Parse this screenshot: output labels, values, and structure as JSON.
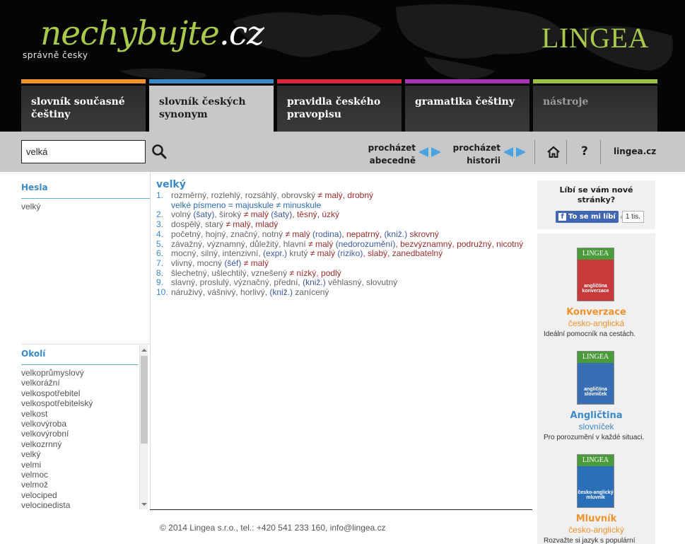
{
  "header": {
    "logo_main": "nechybujte",
    "logo_tld": ".cz",
    "tagline": "správně česky",
    "brand": "LINGEA"
  },
  "tabs": [
    {
      "label": "slovník současné češtiny",
      "color": "#f0922b",
      "state": "normal"
    },
    {
      "label": "slovník českých synonym",
      "color": "#3a89c9",
      "state": "active"
    },
    {
      "label": "pravidla českého pravopisu",
      "color": "#d12a3a",
      "state": "normal"
    },
    {
      "label": "gramatika češtiny",
      "color": "#a535b3",
      "state": "normal"
    },
    {
      "label": "nástroje",
      "color": "#9bc04a",
      "state": "disabled"
    }
  ],
  "toolbar": {
    "search_value": "velká",
    "search_icon": "search-icon",
    "browse_alpha_line1": "procházet",
    "browse_alpha_line2": "abecedně",
    "browse_history_line1": "procházet",
    "browse_history_line2": "historii",
    "home_icon": "home-icon",
    "help_label": "?",
    "site_link": "lingea.cz",
    "arrow_color": "#4aa3df"
  },
  "hesla": {
    "title": "Hesla",
    "items": [
      "velký"
    ]
  },
  "okoli": {
    "title": "Okolí",
    "items": [
      "velkoprůmyslový",
      "velkorážní",
      "velkospotřebitel",
      "velkospotřebitelský",
      "velkost",
      "velkovýroba",
      "velkovýrobní",
      "velkozrnný",
      "velký",
      "velmi",
      "velmoc",
      "velmož",
      "velociped",
      "velocipedista"
    ]
  },
  "entry": {
    "headword": "velký",
    "senses": [
      {
        "num": "1.",
        "parts": [
          {
            "t": "rozměrný, rozlehlý, rozsáhlý, obrovský ",
            "c": "syn"
          },
          {
            "t": "≠ malý, drobný",
            "c": "ant"
          }
        ],
        "note": "velké písmeno = majuskule ≠ minuskule"
      },
      {
        "num": "2.",
        "parts": [
          {
            "t": "volný ",
            "c": "syn"
          },
          {
            "t": "(šaty)",
            "c": "ctx"
          },
          {
            "t": ", široký ",
            "c": "syn"
          },
          {
            "t": "≠ malý ",
            "c": "ant"
          },
          {
            "t": "(šaty)",
            "c": "ctx"
          },
          {
            "t": ", těsný, úzký",
            "c": "ant"
          }
        ]
      },
      {
        "num": "3.",
        "parts": [
          {
            "t": "dospělý, starý ",
            "c": "syn"
          },
          {
            "t": "≠ malý, mladý",
            "c": "ant"
          }
        ]
      },
      {
        "num": "4.",
        "parts": [
          {
            "t": "početný, hojný, značný, notný ",
            "c": "syn"
          },
          {
            "t": "≠ malý ",
            "c": "ant"
          },
          {
            "t": "(rodina)",
            "c": "ctx"
          },
          {
            "t": ", nepatrný, ",
            "c": "ant"
          },
          {
            "t": "(kniž.)",
            "c": "ctx"
          },
          {
            "t": " skrovný",
            "c": "ant"
          }
        ]
      },
      {
        "num": "5.",
        "parts": [
          {
            "t": "závažný, významný, důležitý, hlavní ",
            "c": "syn"
          },
          {
            "t": "≠ malý ",
            "c": "ant"
          },
          {
            "t": "(nedorozumění)",
            "c": "ctx"
          },
          {
            "t": ", bezvýznamný, podružný, nicotný",
            "c": "ant"
          }
        ]
      },
      {
        "num": "6.",
        "parts": [
          {
            "t": "mocný, silný, intenzivní, ",
            "c": "syn"
          },
          {
            "t": "(expr.)",
            "c": "ctx"
          },
          {
            "t": " krutý ",
            "c": "syn"
          },
          {
            "t": "≠ malý ",
            "c": "ant"
          },
          {
            "t": "(riziko)",
            "c": "ctx"
          },
          {
            "t": ", slabý, zanedbatelný",
            "c": "ant"
          }
        ]
      },
      {
        "num": "7.",
        "parts": [
          {
            "t": "vlivný, mocný ",
            "c": "syn"
          },
          {
            "t": "(šéf)",
            "c": "ctx"
          },
          {
            "t": " ≠ malý",
            "c": "ant"
          }
        ]
      },
      {
        "num": "8.",
        "parts": [
          {
            "t": "šlechetný, ušlechtilý, vznešený ",
            "c": "syn"
          },
          {
            "t": "≠ nízký, podlý",
            "c": "ant"
          }
        ]
      },
      {
        "num": "9.",
        "parts": [
          {
            "t": "slavný, proslulý, význačný, přední, ",
            "c": "syn"
          },
          {
            "t": "(kniž.)",
            "c": "ctx"
          },
          {
            "t": " věhlasný, slovutný",
            "c": "syn"
          }
        ]
      },
      {
        "num": "10.",
        "parts": [
          {
            "t": "náruživý, vášnivý, horlivý, ",
            "c": "syn"
          },
          {
            "t": "(kniž.)",
            "c": "ctx"
          },
          {
            "t": " zanícený",
            "c": "syn"
          }
        ]
      }
    ]
  },
  "footer": {
    "text": "© 2014 Lingea s.r.o., tel.: +420 541 233 160, info@lingea.cz"
  },
  "sidebar": {
    "fb_question": "Líbí se vám nové stránky?",
    "fb_button": "To se mi líbí",
    "fb_count": "1 tis.",
    "books": [
      {
        "cover_brand": "LINGEA",
        "cover_text": "angličtina konverzace",
        "title": "Konverzace",
        "title_color": "#f0922b",
        "sub": "česko-anglická",
        "sub_color": "#f0922b",
        "desc": "Ideální pomocník na cestách."
      },
      {
        "cover_brand": "LINGEA",
        "cover_text": "angličtina slovníček",
        "title": "Angličtina",
        "title_color": "#3a89c9",
        "sub": "slovníček",
        "sub_color": "#3a89c9",
        "desc": "Pro porozumění v každé situaci."
      },
      {
        "cover_brand": "LINGEA",
        "cover_text": "česko-anglický mluvník",
        "title": "Mluvník",
        "title_color": "#f0922b",
        "sub": "česko-anglický",
        "sub_color": "#f0922b",
        "desc": "Rozvažte si jazyk s populární"
      }
    ]
  }
}
